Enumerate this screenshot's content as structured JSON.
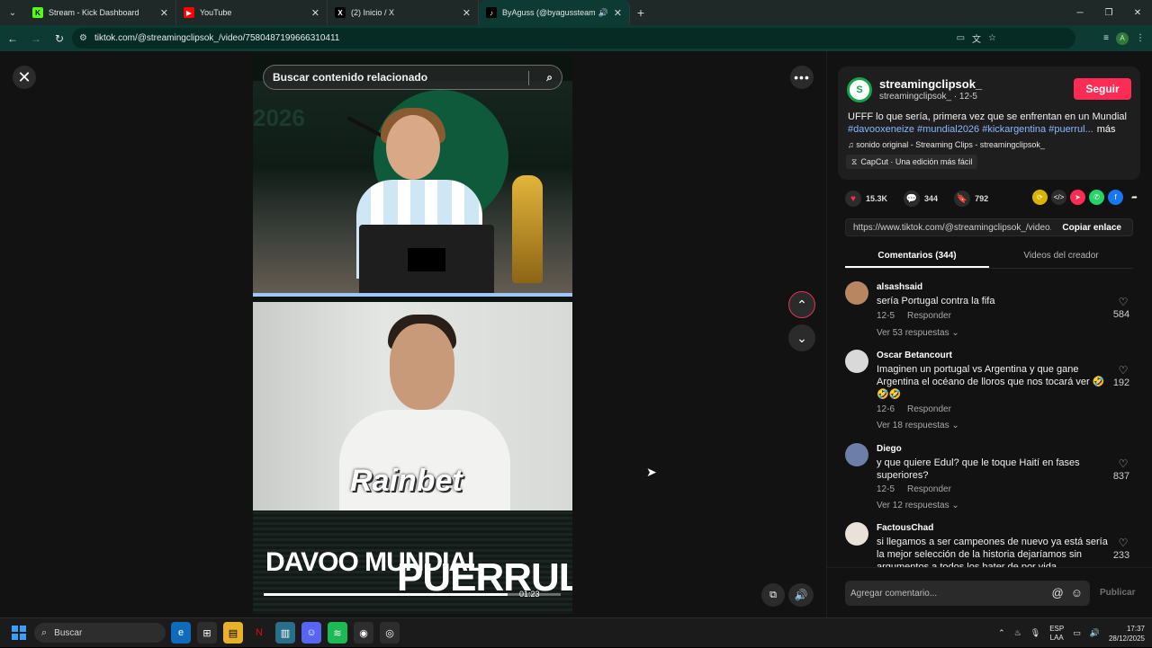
{
  "browser": {
    "tabs": [
      {
        "title": "Stream - Kick Dashboard",
        "icon": "kick-icon",
        "color": "#53fc18"
      },
      {
        "title": "YouTube",
        "icon": "youtube-icon",
        "color": "#ff0000"
      },
      {
        "title": "(2) Inicio / X",
        "icon": "x-icon",
        "color": "#000000"
      },
      {
        "title": "ByAguss (@byagussteam) |",
        "icon": "tiktok-icon",
        "color": "#000000",
        "active": true
      }
    ],
    "url": "tiktok.com/@streamingclipsok_/video/7580487199666310411"
  },
  "video": {
    "search_placeholder": "Buscar contenido relacionado",
    "year_text": "2026",
    "sponsor_text": "Rainbet",
    "banner_left": "DAVOO MUNDIAL",
    "banner_right": "PUERRUL: ¿EU",
    "timecode": "01:23",
    "progress": 0.82
  },
  "post": {
    "author": "streamingclipsok_",
    "author_sub": "streamingclipsok_ · 12-5",
    "follow_label": "Seguir",
    "caption": "UFFF lo que sería, primera vez que se enfrentan en un Mundial",
    "hashtags": "#davooxeneize #mundial2026 #kickargentina #puerrul...",
    "more_label": "más",
    "sound": "sonido original - Streaming Clips - streamingclipsok_",
    "capcut": "CapCut · Una edición más fácil",
    "likes": "15.3K",
    "comments": "344",
    "saves": "792",
    "link": "https://www.tiktok.com/@streamingclipsok_/video...",
    "copy_label": "Copiar enlace",
    "accent": "#fe2c55"
  },
  "panel_tabs": {
    "comments": "Comentarios (344)",
    "creator_videos": "Videos del creador"
  },
  "comments": [
    {
      "user": "alsashsaid",
      "text": "sería Portugal contra la fifa",
      "date": "12-5",
      "reply": "Responder",
      "replies": "Ver 53 respuestas",
      "likes": "584",
      "avatar_color": "#b98662"
    },
    {
      "user": "Oscar Betancourt",
      "text": "Imaginen un portugal vs Argentina y que gane Argentina el océano de lloros que nos tocará ver 🤣 🤣🤣",
      "date": "12-6",
      "reply": "Responder",
      "replies": "Ver 18 respuestas",
      "likes": "192",
      "avatar_color": "#d9d9d9"
    },
    {
      "user": "Diego",
      "text": "y que quiere Edul? que le toque Haití en fases superiores?",
      "date": "12-5",
      "reply": "Responder",
      "replies": "Ver 12 respuestas",
      "likes": "837",
      "avatar_color": "#6d7fa8"
    },
    {
      "user": "FactousChad",
      "text": "si llegamos a ser campeones de nuevo ya está sería la mejor selección de la historia dejaríamos sin argumentos a todos los hater de por vida",
      "likes": "233",
      "avatar_color": "#e8e2d8"
    }
  ],
  "comment_input": {
    "placeholder": "Agregar comentario...",
    "publish_label": "Publicar"
  },
  "taskbar": {
    "search_label": "Buscar",
    "lang_top": "ESP",
    "lang_bottom": "LAA",
    "time": "17:37",
    "date": "28/12/2025"
  }
}
